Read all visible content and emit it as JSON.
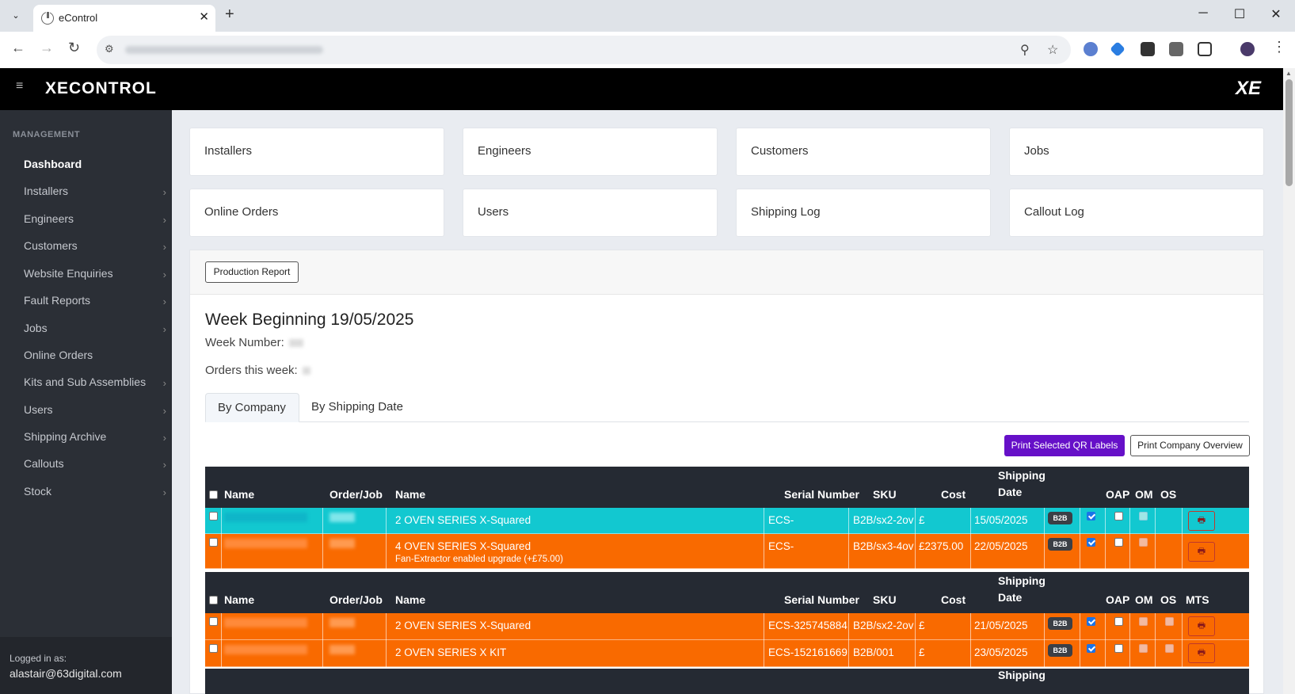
{
  "browser": {
    "tab_title": "eControl",
    "tab_close": "✕",
    "new_tab": "+",
    "window_controls": [
      "─",
      "☐",
      "✕"
    ]
  },
  "app": {
    "logo_text": "XECONTROL",
    "logo_right": "XE"
  },
  "sidebar": {
    "section": "MANAGEMENT",
    "items": [
      {
        "label": "Dashboard",
        "active": true,
        "chevron": false
      },
      {
        "label": "Installers",
        "chevron": true
      },
      {
        "label": "Engineers",
        "chevron": true
      },
      {
        "label": "Customers",
        "chevron": true
      },
      {
        "label": "Website Enquiries",
        "chevron": true
      },
      {
        "label": "Fault Reports",
        "chevron": true
      },
      {
        "label": "Jobs",
        "chevron": true
      },
      {
        "label": "Online Orders",
        "chevron": false
      },
      {
        "label": "Kits and Sub Assemblies",
        "chevron": true
      },
      {
        "label": "Users",
        "chevron": true
      },
      {
        "label": "Shipping Archive",
        "chevron": true
      },
      {
        "label": "Callouts",
        "chevron": true
      },
      {
        "label": "Stock",
        "chevron": true
      }
    ],
    "logged_in_label": "Logged in as:",
    "logged_in_user": "alastair@63digital.com"
  },
  "cards": [
    "Installers",
    "Engineers",
    "Customers",
    "Jobs",
    "Online Orders",
    "Users",
    "Shipping Log",
    "Callout Log"
  ],
  "panel": {
    "production_report": "Production Report",
    "week_title": "Week Beginning 19/05/2025",
    "week_number_label": "Week Number:",
    "orders_label": "Orders this week:",
    "tabs": [
      "By Company",
      "By Shipping Date"
    ],
    "print_qr": "Print Selected QR Labels",
    "print_overview": "Print Company Overview"
  },
  "table_headers": {
    "name": "Name",
    "order_job": "Order/Job",
    "product": "Name",
    "serial": "Serial Number",
    "sku": "SKU",
    "cost": "Cost",
    "shipping_1": "Shipping",
    "shipping_2": "Date",
    "oap": "OAP",
    "om": "OM",
    "os": "OS",
    "mts": "MTS"
  },
  "group1_rows": [
    {
      "product": "2 OVEN SERIES X-Squared",
      "serial": "ECS-",
      "sku": "B2B/sx2-2ov",
      "cost": "£",
      "date": "15/05/2025",
      "badge": "B2B",
      "color": "#12c8d0"
    },
    {
      "product": "4 OVEN SERIES X-Squared",
      "sub": "Fan-Extractor enabled upgrade (+£75.00)",
      "serial": "ECS-",
      "sku": "B2B/sx3-4ov",
      "cost": "£2375.00",
      "date": "22/05/2025",
      "badge": "B2B",
      "color": "#f96a00"
    }
  ],
  "group2_rows": [
    {
      "product": "2 OVEN SERIES X-Squared",
      "serial": "ECS-325745884",
      "sku": "B2B/sx2-2ov",
      "cost": "£",
      "date": "21/05/2025",
      "badge": "B2B",
      "color": "#f96a00"
    },
    {
      "product": "2 OVEN SERIES X KIT",
      "serial": "ECS-152161669",
      "sku": "B2B/001",
      "cost": "£",
      "date": "23/05/2025",
      "badge": "B2B",
      "color": "#f96a00"
    }
  ],
  "print_icon": "printer-icon"
}
